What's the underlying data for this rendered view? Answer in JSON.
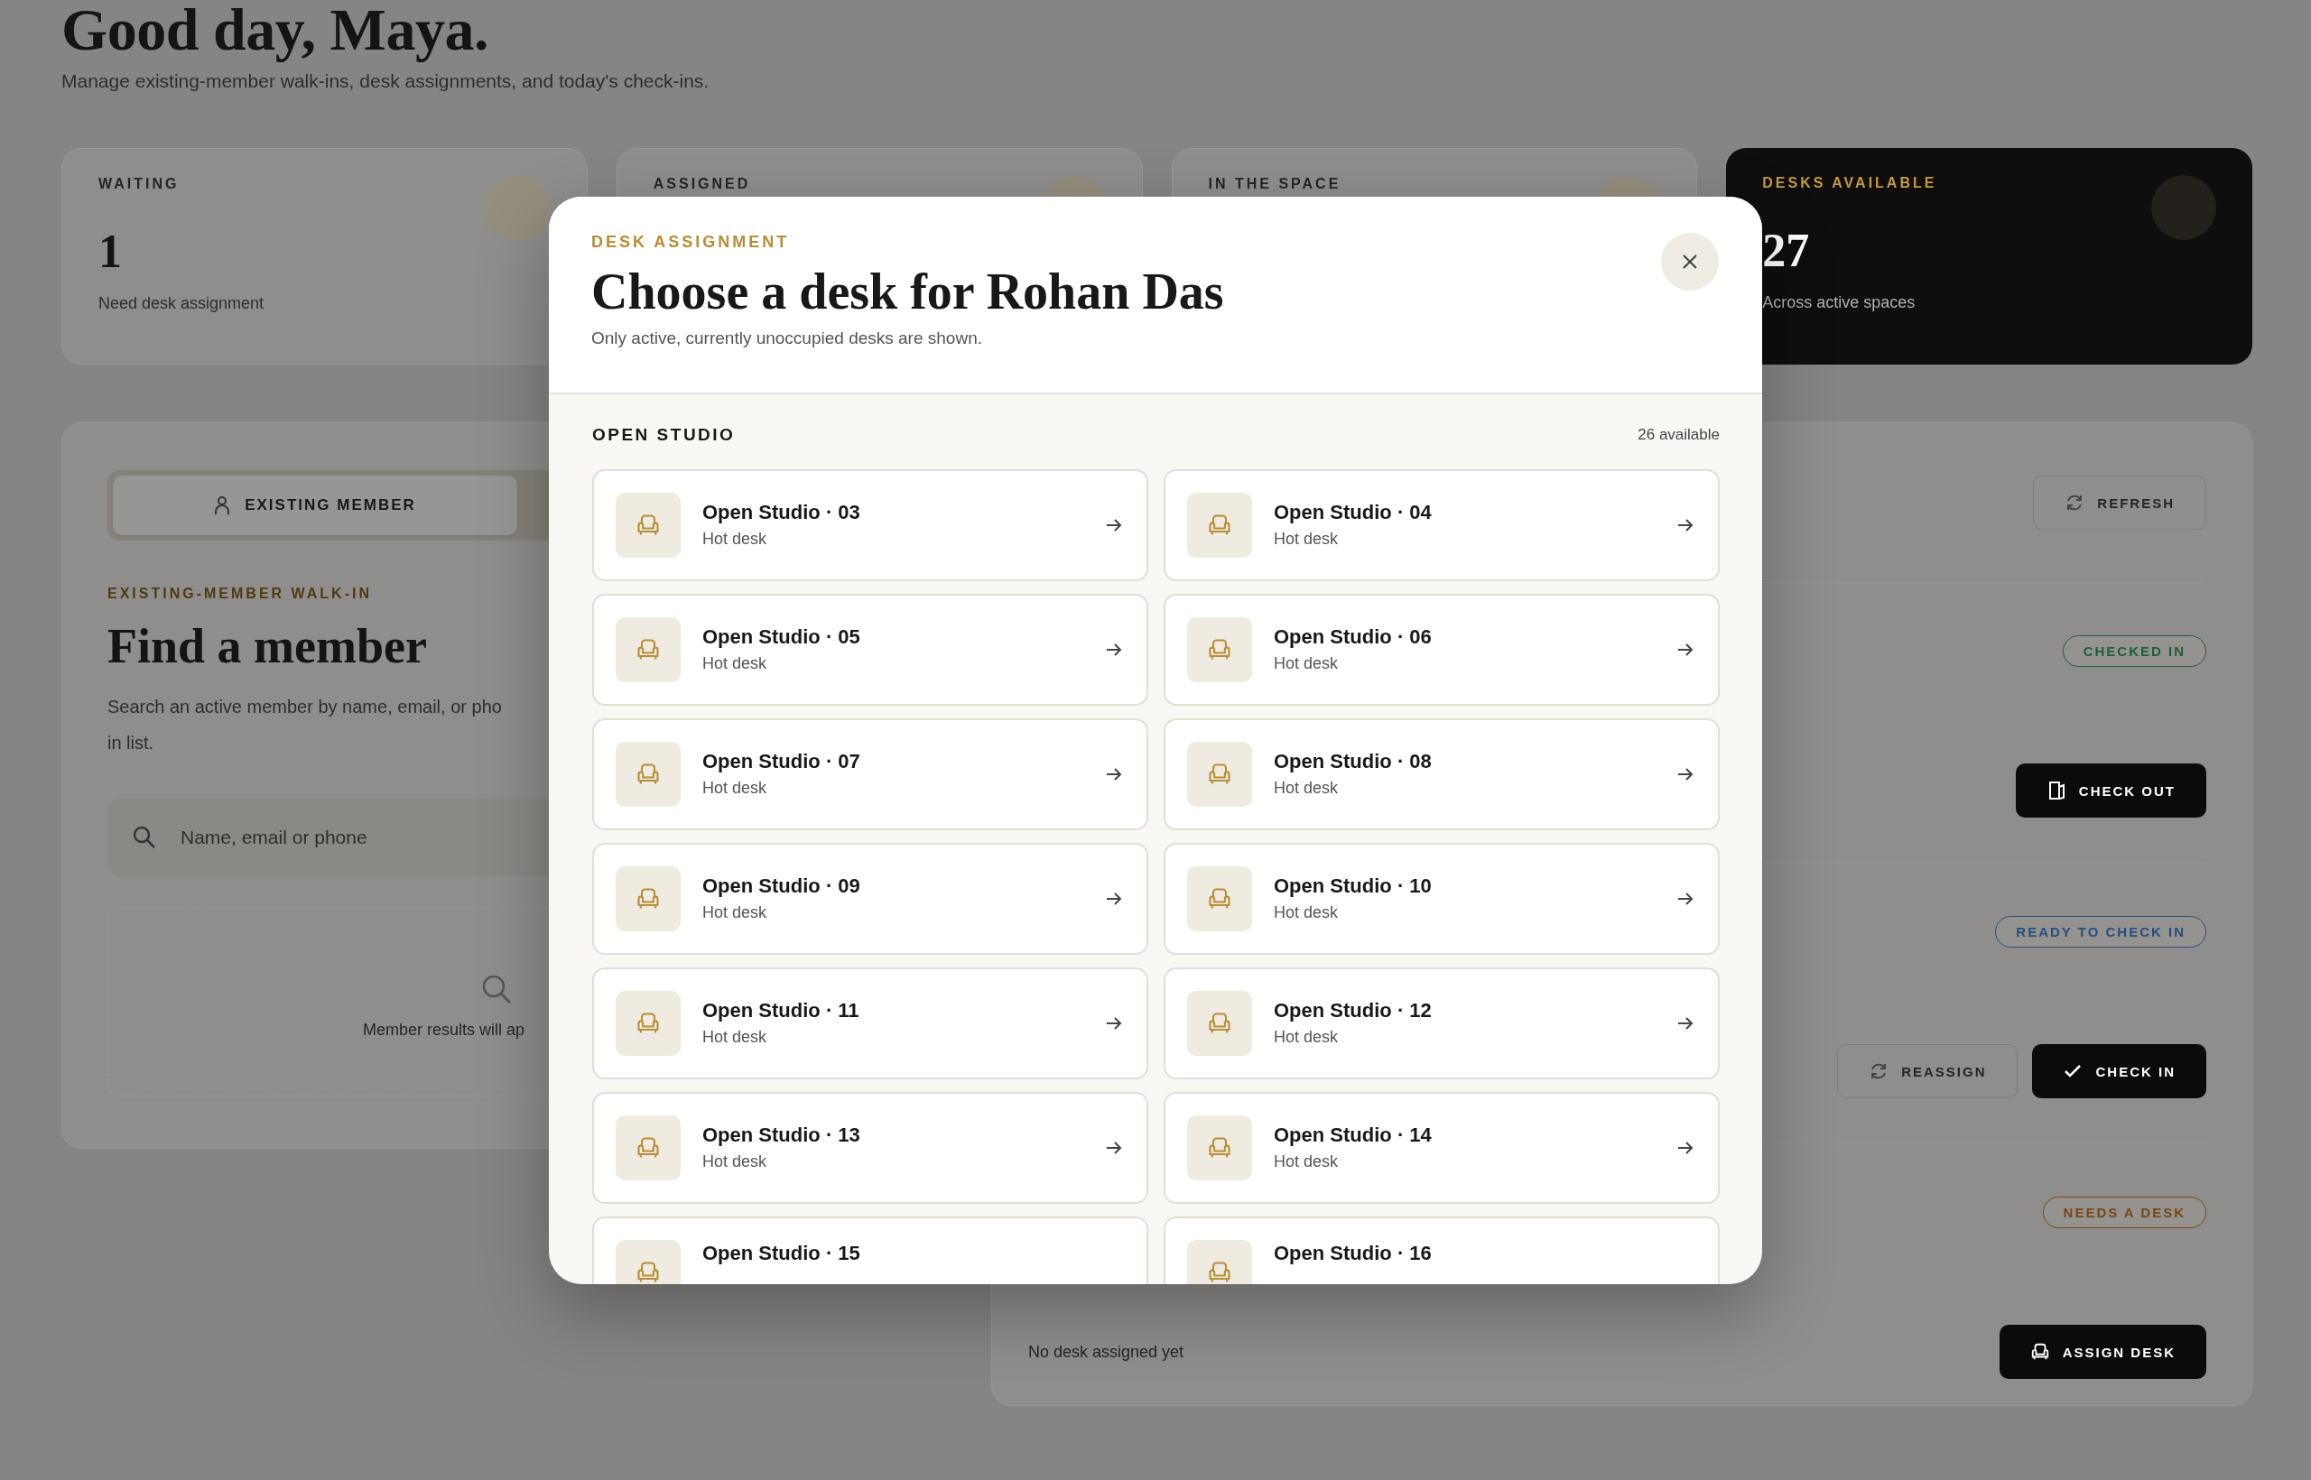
{
  "page": {
    "greeting": "Good day, Maya.",
    "subtitle": "Manage existing-member walk-ins, desk assignments, and today's check-ins."
  },
  "stats": [
    {
      "label": "WAITING",
      "value": "1",
      "note": "Need desk assignment",
      "kind": "light"
    },
    {
      "label": "ASSIGNED",
      "kind": "light"
    },
    {
      "label": "IN THE SPACE",
      "kind": "light"
    },
    {
      "label": "DESKS AVAILABLE",
      "value": "27",
      "note": "Across active spaces",
      "kind": "dark"
    }
  ],
  "walk_in": {
    "tab": {
      "label": "EXISTING MEMBER",
      "selected": true
    },
    "eyebrow": "EXISTING-MEMBER WALK-IN",
    "title": "Find a member",
    "description": "Search an active member by name, email, or pho",
    "description_end": "in list.",
    "search": {
      "placeholder": "Name, email or phone"
    },
    "empty_text": "Member results will ap"
  },
  "queue": {
    "refresh": "REFRESH",
    "rows": [
      {
        "kind": "badge",
        "text": "CHECKED IN",
        "color": "#1f5e3c"
      },
      {
        "kind": "actions",
        "buttons": [
          {
            "label": "CHECK OUT",
            "kind": "checkout"
          }
        ]
      },
      {
        "kind": "badge",
        "text": "READY TO CHECK IN",
        "color": "#24507e"
      },
      {
        "kind": "actions",
        "buttons": [
          {
            "label": "REASSIGN",
            "kind": "reassign"
          },
          {
            "label": "CHECK IN",
            "kind": "checkin"
          }
        ]
      },
      {
        "kind": "badge",
        "text": "NEEDS A DESK",
        "color": "#7a4712"
      },
      {
        "kind": "actions",
        "note": "No desk assigned yet",
        "buttons": [
          {
            "label": "ASSIGN DESK",
            "kind": "assign"
          }
        ]
      }
    ]
  },
  "modal": {
    "eyebrow": "DESK ASSIGNMENT",
    "title": "Choose a desk for Rohan Das",
    "subtitle": "Only active, currently unoccupied desks are shown.",
    "section": {
      "title": "OPEN STUDIO",
      "count": "26 available",
      "desks": [
        {
          "name": "Open Studio · 03",
          "type": "Hot desk"
        },
        {
          "name": "Open Studio · 04",
          "type": "Hot desk"
        },
        {
          "name": "Open Studio · 05",
          "type": "Hot desk"
        },
        {
          "name": "Open Studio · 06",
          "type": "Hot desk"
        },
        {
          "name": "Open Studio · 07",
          "type": "Hot desk"
        },
        {
          "name": "Open Studio · 08",
          "type": "Hot desk"
        },
        {
          "name": "Open Studio · 09",
          "type": "Hot desk"
        },
        {
          "name": "Open Studio · 10",
          "type": "Hot desk"
        },
        {
          "name": "Open Studio · 11",
          "type": "Hot desk"
        },
        {
          "name": "Open Studio · 12",
          "type": "Hot desk"
        },
        {
          "name": "Open Studio · 13",
          "type": "Hot desk"
        },
        {
          "name": "Open Studio · 14",
          "type": "Hot desk"
        },
        {
          "name": "Open Studio · 15"
        },
        {
          "name": "Open Studio · 16"
        }
      ]
    }
  }
}
